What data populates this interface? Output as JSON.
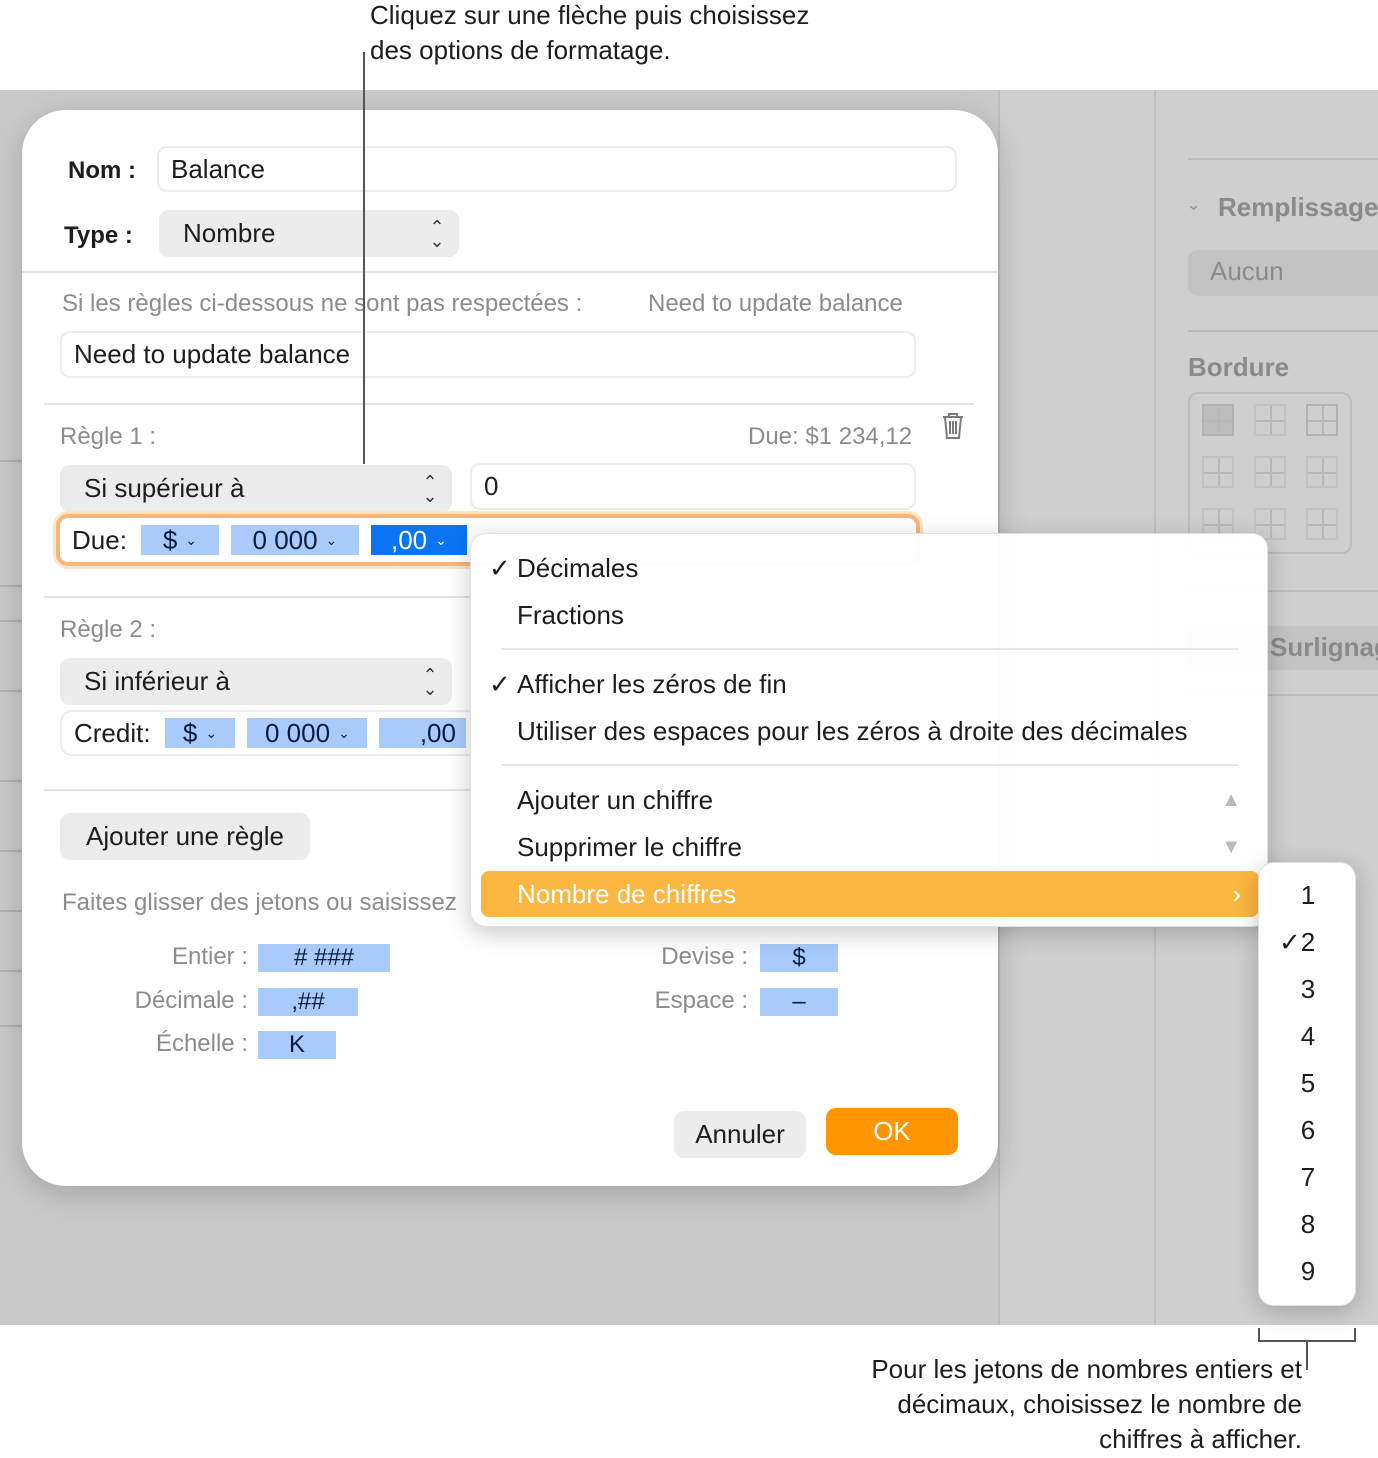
{
  "callouts": {
    "top_line1": "Cliquez sur une flèche puis choisissez",
    "top_line2": "des options de formatage.",
    "bottom_line1": "Pour les jetons de nombres entiers et",
    "bottom_line2": "décimaux, choisissez le nombre de",
    "bottom_line3": "chiffres à afficher."
  },
  "right_panel": {
    "fill_label": "Remplissage",
    "fill_value": "Aucun",
    "border_label": "Bordure",
    "highlight_label": "Surlignag"
  },
  "dialog": {
    "name_label": "Nom :",
    "name_value": "Balance",
    "type_label": "Type :",
    "type_value": "Nombre",
    "unmet_label": "Si les règles ci-dessous ne sont pas respectées :",
    "unmet_preview": "Need to update balance",
    "unmet_value": "Need to update balance",
    "rule1": {
      "label": "Règle 1 :",
      "preview": "Due: $1 234,12",
      "condition": "Si supérieur à",
      "value": "0",
      "field_name": "Due:",
      "tokens": [
        "$",
        "0 000",
        ",00"
      ]
    },
    "rule2": {
      "label": "Règle 2 :",
      "condition": "Si inférieur à",
      "field_name": "Credit:",
      "tokens": [
        "$",
        "0 000",
        ",00"
      ]
    },
    "add_rule": "Ajouter une règle",
    "drag_hint": "Faites glisser des jetons ou saisissez",
    "legend": {
      "integer_label": "Entier :",
      "integer_token": "# ###",
      "decimal_label": "Décimale :",
      "decimal_token": ",##",
      "scale_label": "Échelle :",
      "scale_token": "K",
      "currency_label": "Devise :",
      "currency_token": "$",
      "space_label": "Espace :",
      "space_token": "–"
    },
    "cancel": "Annuler",
    "ok": "OK"
  },
  "menu": {
    "decimals": "Décimales",
    "fractions": "Fractions",
    "show_trailing_zeros": "Afficher les zéros de fin",
    "use_spaces": "Utiliser des espaces pour les zéros à droite des décimales",
    "add_digit": "Ajouter un chiffre",
    "remove_digit": "Supprimer le chiffre",
    "digit_count": "Nombre de chiffres"
  },
  "submenu": {
    "options": [
      "1",
      "2",
      "3",
      "4",
      "5",
      "6",
      "7",
      "8",
      "9"
    ],
    "selected": "2"
  },
  "colors": {
    "accent": "#ff9500",
    "highlight": "#fbb741",
    "token": "#a8cbfb",
    "token_selected": "#0a74f5"
  }
}
